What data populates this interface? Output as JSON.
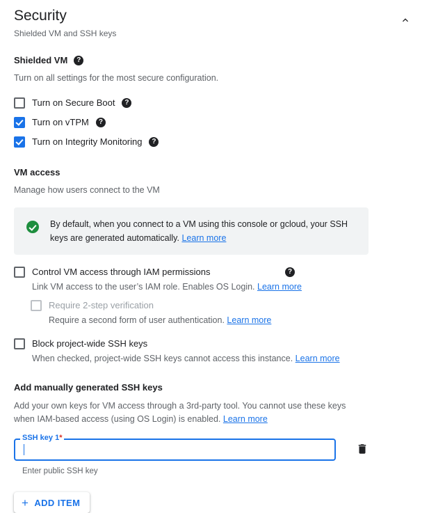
{
  "panel": {
    "title": "Security",
    "subtitle": "Shielded VM and SSH keys",
    "collapse_icon": "chevron-up-icon"
  },
  "shielded_vm": {
    "title": "Shielded VM",
    "help_icon": "help-icon",
    "description": "Turn on all settings for the most secure configuration.",
    "options": [
      {
        "label": "Turn on Secure Boot",
        "checked": false,
        "help_icon": "help-icon"
      },
      {
        "label": "Turn on vTPM",
        "checked": true,
        "help_icon": "help-icon"
      },
      {
        "label": "Turn on Integrity Monitoring",
        "checked": true,
        "help_icon": "help-icon"
      }
    ]
  },
  "vm_access": {
    "title": "VM access",
    "description": "Manage how users connect to the VM",
    "banner": {
      "icon": "check-circle-icon",
      "text": "By default, when you connect to a VM using this console or gcloud, your SSH keys are generated automatically.",
      "link": "Learn more"
    },
    "iam_option": {
      "label": "Control VM access through IAM permissions",
      "checked": false,
      "help_icon": "help-icon",
      "sub_text": "Link VM access to the user’s IAM role. Enables OS Login.",
      "sub_link": "Learn more"
    },
    "two_step_option": {
      "label": "Require 2-step verification",
      "checked": false,
      "disabled": true,
      "sub_text": "Require a second form of user authentication.",
      "sub_link": "Learn more"
    },
    "block_keys_option": {
      "label": "Block project-wide SSH keys",
      "checked": false,
      "sub_text": "When checked, project-wide SSH keys cannot access this instance.",
      "sub_link": "Learn more"
    }
  },
  "ssh_keys": {
    "title": "Add manually generated SSH keys",
    "description": "Add your own keys for VM access through a 3rd-party tool. You cannot use these keys when IAM-based access (using OS Login) is enabled.",
    "description_link": "Learn more",
    "field": {
      "label": "SSH key 1",
      "required_marker": "*",
      "value": "",
      "placeholder": "",
      "hint": "Enter public SSH key",
      "delete_icon": "trash-icon"
    },
    "add_button": {
      "label": "ADD ITEM",
      "icon": "plus-icon"
    }
  },
  "colors": {
    "accent": "#1a73e8",
    "success": "#1e8e3e",
    "required": "#d93025",
    "banner_bg": "#f1f3f4",
    "text": "#202124",
    "muted": "#5f6368",
    "disabled": "#9aa0a6"
  }
}
